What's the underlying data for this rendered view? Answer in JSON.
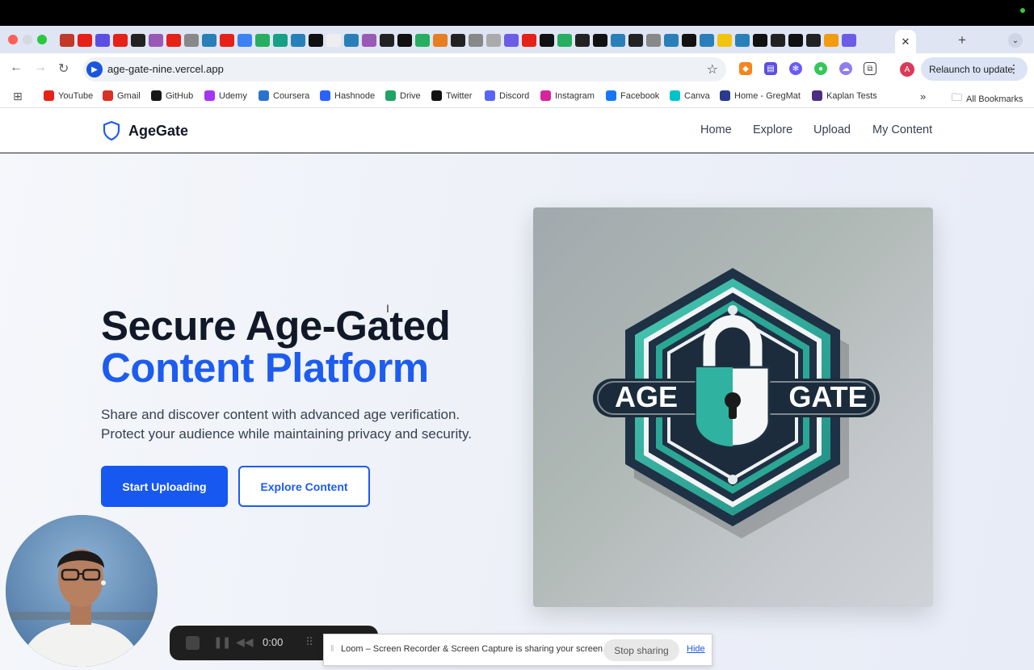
{
  "browser": {
    "address": {
      "url": "age-gate-nine.vercel.app"
    },
    "relaunch_label": "Relaunch to update",
    "profile_initial": "A",
    "bookmarks": [
      {
        "label": "YouTube",
        "icon": "youtube-icon",
        "color": "#e62117"
      },
      {
        "label": "Gmail",
        "icon": "gmail-icon",
        "color": "#d93025"
      },
      {
        "label": "GitHub",
        "icon": "github-icon",
        "color": "#181717"
      },
      {
        "label": "Udemy",
        "icon": "udemy-icon",
        "color": "#a435f0"
      },
      {
        "label": "Coursera",
        "icon": "coursera-icon",
        "color": "#2a73cc"
      },
      {
        "label": "Hashnode",
        "icon": "hashnode-icon",
        "color": "#2962ff"
      },
      {
        "label": "Drive",
        "icon": "drive-icon",
        "color": "#1fa463"
      },
      {
        "label": "Twitter",
        "icon": "twitter-icon",
        "color": "#111111"
      },
      {
        "label": "Discord",
        "icon": "discord-icon",
        "color": "#5865f2"
      },
      {
        "label": "Instagram",
        "icon": "instagram-icon",
        "color": "#d6249f"
      },
      {
        "label": "Facebook",
        "icon": "facebook-icon",
        "color": "#1877f2"
      },
      {
        "label": "Canva",
        "icon": "canva-icon",
        "color": "#00c4cc"
      },
      {
        "label": "Home - GregMat",
        "icon": "gregmat-icon",
        "color": "#2b3a8c"
      },
      {
        "label": "Kaplan Tests",
        "icon": "kaplan-icon",
        "color": "#4b2e83"
      }
    ],
    "all_bookmarks_label": "All Bookmarks"
  },
  "site": {
    "brand": "AgeGate",
    "nav": [
      "Home",
      "Explore",
      "Upload",
      "My Content"
    ],
    "hero": {
      "title_line1": "Secure Age-Gated",
      "title_line2": "Content Platform",
      "subtitle_line1": "Share and discover content with advanced age verification.",
      "subtitle_line2": "Protect your audience while maintaining privacy and security.",
      "primary_cta": "Start Uploading",
      "secondary_cta": "Explore Content"
    },
    "logo_image": {
      "word_left": "AGE",
      "word_right": "GATE"
    },
    "colors": {
      "accent": "#1d5cf0",
      "title": "#111827",
      "logo_teal": "#2fb3a0",
      "logo_navy": "#1f3145"
    }
  },
  "loom": {
    "timer": "0:00",
    "share_message": "Loom – Screen Recorder & Screen Capture is sharing your screen.",
    "stop_label": "Stop sharing",
    "hide_label": "Hide"
  }
}
